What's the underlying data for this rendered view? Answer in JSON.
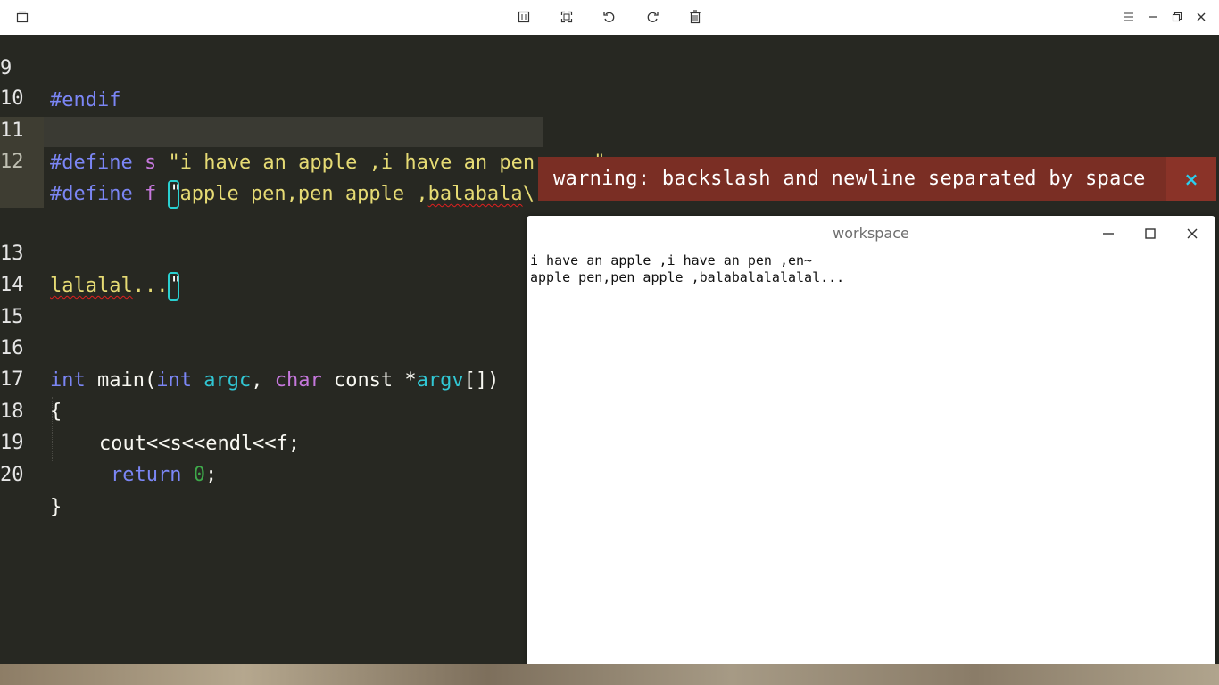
{
  "toolbar": {
    "left_icon": "window-icon",
    "center_icons": [
      "split-view-icon",
      "fullscreen-icon",
      "undo-icon",
      "redo-icon",
      "delete-icon"
    ],
    "right_icons": [
      "menu-icon",
      "minimize-icon",
      "restore-icon",
      "close-icon"
    ]
  },
  "editor": {
    "lines": [
      {
        "num": "9",
        "text": "#endif"
      },
      {
        "num": "10",
        "text": ""
      },
      {
        "num": "11",
        "directive": "#define",
        "name": "s",
        "value": "\"i have an apple ,i have an pen ,en~\""
      },
      {
        "num": "12",
        "directive": "#define",
        "name": "f",
        "quote": "\"",
        "value": "apple pen,pen apple ,",
        "squiggle": "balabala",
        "backslash": "\\",
        "trailing": "·"
      },
      {
        "num": "13",
        "squiggle": "lalalal",
        "value": "...",
        "quote": "\""
      },
      {
        "num": "14",
        "text": ""
      },
      {
        "num": "15",
        "text": ""
      },
      {
        "num": "16",
        "t1": "int",
        "t2": "main(",
        "t3": "int",
        "t4": "argc",
        "t5": ", ",
        "t6": "char",
        "t7": " const *",
        "t8": "argv",
        "t9": "[])"
      },
      {
        "num": "17",
        "text": "{"
      },
      {
        "num": "18",
        "text": "cout<<s<<endl<<f;"
      },
      {
        "num": "19",
        "kw": "return",
        "val": "0",
        "end": ";"
      },
      {
        "num": "20",
        "text": "}"
      }
    ]
  },
  "warning": {
    "message": "warning: backslash and newline separated by space",
    "close": "×"
  },
  "workspace": {
    "title": "workspace",
    "output_line1": "i have an apple ,i have an pen ,en~",
    "output_line2": "apple pen,pen apple ,balabalalalalal..."
  },
  "colors": {
    "editor_bg": "#272822",
    "keyword_blue": "#7b86f5",
    "keyword_purple": "#c678dd",
    "identifier_cyan": "#31c7d4",
    "string": "#e6db74",
    "number": "#3ea84a",
    "warning_bg": "#7a2e24",
    "cursor": "#2ad0d0"
  }
}
